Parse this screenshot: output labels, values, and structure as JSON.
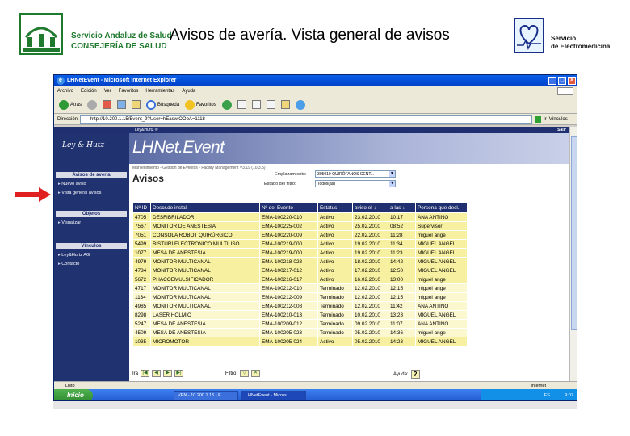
{
  "slide": {
    "title": "Avisos de avería. Vista general de avisos",
    "left_logo_line1": "Servicio Andaluz de Salud",
    "left_logo_line2": "CONSEJERÍA DE SALUD",
    "right_logo_line1": "Servicio",
    "right_logo_line2": "de Electromedicina"
  },
  "browser": {
    "title": "LHNetEvent - Microsoft Internet Explorer",
    "menu": [
      "Archivo",
      "Edición",
      "Ver",
      "Favoritos",
      "Herramientas",
      "Ayuda"
    ],
    "toolbar": {
      "back": "Atrás",
      "search": "Búsqueda",
      "favorites": "Favoritos"
    },
    "address_label": "Dirección",
    "address": "http://10.200.1.15/Event_9?User=hEaswiOObA=1118",
    "go_label": "Ir",
    "links_label": "Vínculos",
    "status_left": "Listo",
    "status_zone": "Internet"
  },
  "app": {
    "top_left": "Ley&Hurtz ®",
    "logout": "Salir",
    "brand": "Ley & Hutz",
    "product": "LHNet.Event",
    "breadcrumb": "Mantenimiento - Gestión de Eventos - Facility Management V3.19 (10.3.5)",
    "page_title": "Avisos",
    "sidebar": {
      "sections": [
        {
          "title": "Avisos de avería",
          "items": [
            "Nuevo aviso",
            "Vista general avisos"
          ]
        },
        {
          "title": "Objetos",
          "items": [
            "Visualizar"
          ]
        },
        {
          "title": "Vínculos",
          "items": [
            "Ley&Hurtz AG",
            "Contacto"
          ]
        }
      ]
    },
    "filters": {
      "location_label": "Emplazamiento:",
      "location_value": "305010 QUIRÓFANOS CENT...",
      "state_label": "Estado del filtro:",
      "state_value": "Todos(as)"
    },
    "table": {
      "columns": [
        "Nº ID",
        "Descr.de instal.",
        "Nº del Evento",
        "Estatus",
        "aviso el ↓",
        "a las ↓",
        "Persona que decl."
      ],
      "rows": [
        {
          "id": "4705",
          "desc": "DESFIBRILADOR",
          "event": "EMA-100220-010",
          "status": "Activo",
          "date": "23.02.2010",
          "time": "10:17",
          "person": "ANA ANTINO"
        },
        {
          "id": "7567",
          "desc": "MONITOR DE ANESTESIA",
          "event": "EMA-100225-002",
          "status": "Activo",
          "date": "25.02.2010",
          "time": "08:52",
          "person": "Supervisor"
        },
        {
          "id": "7051",
          "desc": "CONSOLA ROBOT QUIRÚRGICO",
          "event": "EMA-100220-009",
          "status": "Activo",
          "date": "22.02.2010",
          "time": "11:28",
          "person": "miguel ange"
        },
        {
          "id": "5499",
          "desc": "BISTURÍ ELECTRÓNICO MULTIUSO",
          "event": "EMA-100219-000",
          "status": "Activo",
          "date": "19.02.2010",
          "time": "11:34",
          "person": "MIGUEL ANGEL"
        },
        {
          "id": "1077",
          "desc": "MESA DE ANESTESIA",
          "event": "EMA-100219-000",
          "status": "Activo",
          "date": "19.02.2010",
          "time": "11:23",
          "person": "MIGUEL ANGEL"
        },
        {
          "id": "4979",
          "desc": "MONITOR MULTICANAL",
          "event": "EMA-100218-023",
          "status": "Activo",
          "date": "18.02.2010",
          "time": "14:42",
          "person": "MIGUEL ANGEL"
        },
        {
          "id": "4734",
          "desc": "MONITOR MULTICANAL",
          "event": "EMA-100217-012",
          "status": "Activo",
          "date": "17.02.2010",
          "time": "12:50",
          "person": "MIGUEL ANGEL"
        },
        {
          "id": "5672",
          "desc": "PHACOEMULSIFICADOR",
          "event": "EMA-100216-017",
          "status": "Activo",
          "date": "16.02.2010",
          "time": "13:00",
          "person": "miguel ange"
        },
        {
          "id": "4717",
          "desc": "MONITOR MULTICANAL",
          "event": "EMA-100212-010",
          "status": "Terminado",
          "date": "12.02.2010",
          "time": "12:15",
          "person": "miguel ange"
        },
        {
          "id": "1134",
          "desc": "MONITOR MULTICANAL",
          "event": "EMA-100212-009",
          "status": "Terminado",
          "date": "12.02.2010",
          "time": "12:15",
          "person": "miguel ange"
        },
        {
          "id": "4985",
          "desc": "MONITOR MULTICANAL",
          "event": "EMA-100212-008",
          "status": "Terminado",
          "date": "12.02.2010",
          "time": "11:42",
          "person": "ANA ANTINO"
        },
        {
          "id": "8298",
          "desc": "LASER HOLMIO",
          "event": "EMA-100210-013",
          "status": "Terminado",
          "date": "10.02.2010",
          "time": "13:23",
          "person": "MIGUEL ANGEL"
        },
        {
          "id": "5247",
          "desc": "MESA DE ANESTESIA",
          "event": "EMA-100209-012",
          "status": "Terminado",
          "date": "09.02.2010",
          "time": "11:07",
          "person": "ANA ANTINO"
        },
        {
          "id": "4509",
          "desc": "MESA DE ANESTESIA",
          "event": "EMA-100205-023",
          "status": "Terminado",
          "date": "05.02.2010",
          "time": "14:36",
          "person": "miguel ange"
        },
        {
          "id": "1035",
          "desc": "MICROMOTOR",
          "event": "EMA-100205-024",
          "status": "Activo",
          "date": "05.02.2010",
          "time": "14:23",
          "person": "MIGUEL ANGEL"
        }
      ]
    },
    "pager_label": "Ira",
    "filter_label": "Filtro:",
    "help_label": "Ayuda:",
    "help_icon": "?"
  },
  "taskbar": {
    "start": "Inicio",
    "tasks": [
      "VPN - 10.200.1.15 - E...",
      "LHNetEvent - Micros..."
    ],
    "language": "ES",
    "clock": "9:07"
  },
  "colors": {
    "nav_blue": "#1f2f6f",
    "active_row": "#f7f0a0",
    "finished_row": "#fbf7cf",
    "arrow_red": "#e02020"
  }
}
